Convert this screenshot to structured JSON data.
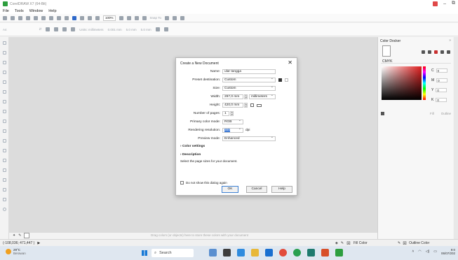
{
  "window": {
    "title": "CorelDRAW X7 (64-Bit)"
  },
  "menu": [
    "File",
    "Tools",
    "Window",
    "Help"
  ],
  "toolbar": {
    "zoom": "100%",
    "snap_to": "Snap To"
  },
  "property_bar": {
    "page": "A4",
    "units": "Units: millimeters",
    "nudge": "0.001 mm",
    "dup_x": "5.0 mm",
    "dup_y": "5.0 mm"
  },
  "canvas": {
    "hint": "Drag colors (or objects) here to store these colors with your document"
  },
  "docker": {
    "title": "Color Docker",
    "model": "CMYK",
    "channels": [
      {
        "name": "C",
        "value": "0"
      },
      {
        "name": "M",
        "value": "0"
      },
      {
        "name": "Y",
        "value": "0"
      },
      {
        "name": "K",
        "value": "0"
      }
    ],
    "fill_label": "Fill",
    "outline_label": "Outline"
  },
  "status": {
    "coords": "(-108,036; 471,447 )",
    "fill": "Fill Color",
    "outline": "Outline Color"
  },
  "dialog": {
    "title": "Create a New Document",
    "close": "✕",
    "fields": {
      "name_label": "Name:",
      "name_value": "ular tangga",
      "preset_label": "Preset destination:",
      "preset_value": "Custom",
      "size_label": "Size:",
      "size_value": "Custom",
      "width_label": "Width:",
      "width_value": "297,0 mm",
      "width_unit": "millimeters",
      "height_label": "Height:",
      "height_value": "420,0 mm",
      "pages_label": "Number of pages:",
      "pages_value": "1",
      "color_mode_label": "Primary color mode:",
      "color_mode_value": "RGB",
      "resolution_label": "Rendering resolution:",
      "resolution_value": "300",
      "resolution_unit": "dpi",
      "preview_label": "Preview mode:",
      "preview_value": "Enhanced"
    },
    "color_settings": "Color settings",
    "description_header": "Description",
    "description_text": "Select the page sizes for your document.",
    "dont_show": "Do not show this dialog again",
    "ok": "OK",
    "cancel": "Cancel",
    "help": "Help"
  },
  "taskbar": {
    "temp": "29°C",
    "weather": "Berawan",
    "search": "Search",
    "time": "9:0",
    "date": "06/07/202"
  }
}
